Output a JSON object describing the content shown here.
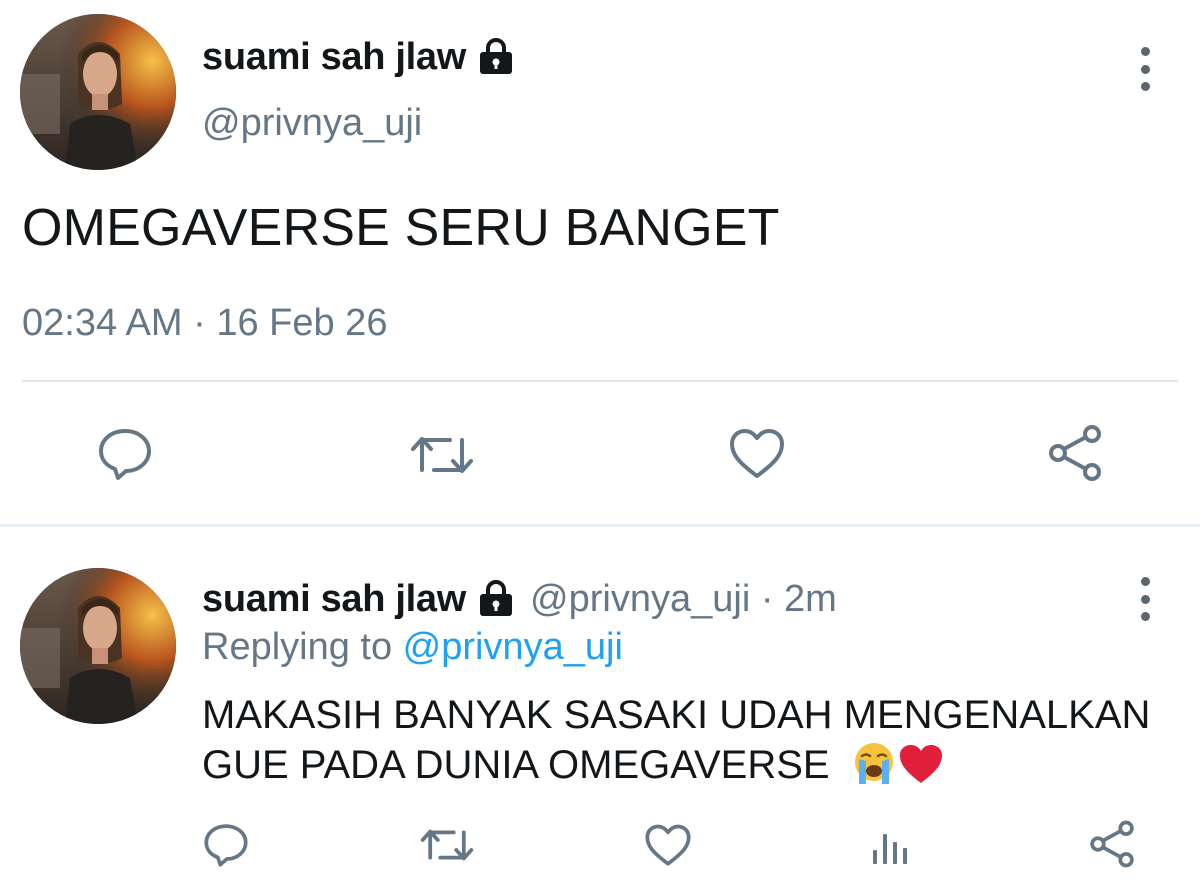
{
  "main_tweet": {
    "display_name": "suami sah jlaw",
    "handle": "@privnya_uji",
    "text": "OMEGAVERSE SERU BANGET",
    "timestamp": "02:34 AM · 16 Feb 26",
    "icons": [
      "lock-icon",
      "more-vertical-icon",
      "reply-icon",
      "retweet-icon",
      "like-icon",
      "share-icon"
    ]
  },
  "reply_tweet": {
    "display_name": "suami sah jlaw",
    "handle": "@privnya_uji",
    "separator": " · ",
    "age": "2m",
    "replying_prefix": "Replying to ",
    "replying_to": "@privnya_uji",
    "text_line1": "MAKASIH BANYAK SASAKI UDAH MENGENALKAN",
    "text_line2": "GUE PADA DUNIA OMEGAVERSE",
    "emojis": [
      "loudly-crying-face-emoji",
      "red-heart-emoji"
    ],
    "icons": [
      "lock-icon",
      "more-vertical-icon",
      "reply-icon",
      "retweet-icon",
      "like-icon",
      "analytics-icon",
      "share-icon"
    ]
  },
  "colors": {
    "text_primary": "#14171a",
    "text_secondary": "#657786",
    "link": "#1da1f2",
    "icon": "#657786",
    "divider": "#e1e8ed"
  }
}
